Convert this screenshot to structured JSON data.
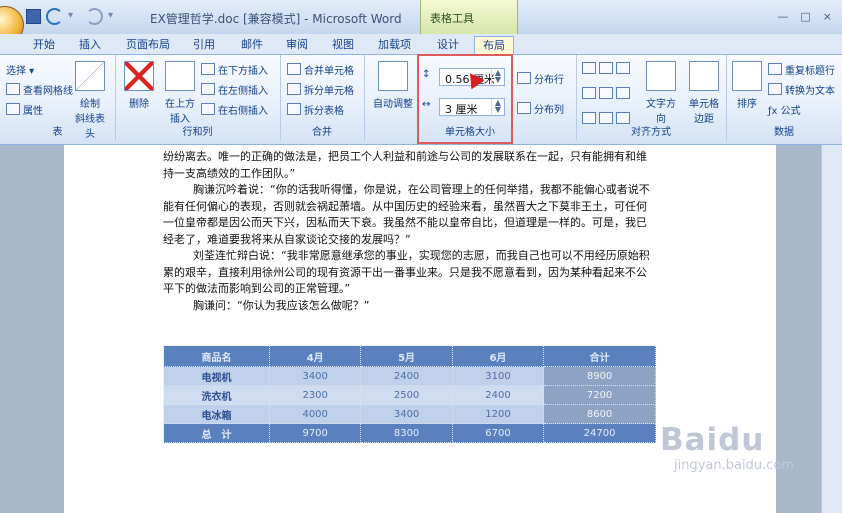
{
  "titlebar": {
    "title": "EX管理哲学.doc [兼容模式] - Microsoft Word",
    "context": "表格工具"
  },
  "tabs": [
    "开始",
    "插入",
    "页面布局",
    "引用",
    "邮件",
    "审阅",
    "视图",
    "加载项",
    "设计",
    "布局"
  ],
  "ribbon": {
    "table": {
      "select": "选择",
      "gridlines": "查看网格线",
      "props": "属性",
      "draw": "绘制",
      "draw2": "斜线表头",
      "title": "表"
    },
    "rowcol": {
      "delete": "删除",
      "insert_above": "在上方",
      "insert2": "插入",
      "below": "在下方插入",
      "left": "在左侧插入",
      "right": "在右侧插入",
      "title": "行和列"
    },
    "merge": {
      "merge_cells": "合并单元格",
      "split_cells": "拆分单元格",
      "split_table": "拆分表格",
      "title": "合并"
    },
    "cellsize": {
      "autofit": "自动调整",
      "height": "0.56 厘米",
      "width": "3 厘米",
      "dist_rows": "分布行",
      "dist_cols": "分布列",
      "title": "单元格大小"
    },
    "align": {
      "direction": "文字方向",
      "margins": "单元格",
      "margins2": "边距",
      "title": "对齐方式"
    },
    "data": {
      "sort": "排序",
      "repeat": "重复标题行",
      "convert": "转换为文本",
      "formula": "公式",
      "title": "数据"
    }
  },
  "document": {
    "paragraphs": [
      "纷纷离去。唯一的正确的做法是，把员工个人利益和前途与公司的发展联系在一起，只有能拥有和维持一支高绩效的工作团队。”",
      "胸谦沉吟着说：“你的话我听得懂，你是说，在公司管理上的任何举措，我都不能偏心或者说不能有任何偏心的表现，否则就会祸起萧墙。从中国历史的经验来看，虽然晋大之下莫非王土，可任何一位皇帝都是因公而天下兴，因私而天下衰。我虽然不能以皇帝自比，但道理是一样的。可是，我已经老了，难道要我将来从自家谈论交接的发展吗？”",
      "刘荃连忙辩白说：“我非常愿意继承您的事业，实现您的志愿，而我自己也可以不用经历原始积累的艰辛，直接利用徐州公司的现有资源干出一番事业来。只是我不愿意看到，因为某种看起来不公平下的做法而影响到公司的正常管理。”",
      "胸谦问：“你认为我应该怎么做呢？”"
    ],
    "table": {
      "headers": [
        "商品名",
        "4月",
        "5月",
        "6月",
        "合计"
      ],
      "rows": [
        [
          "电视机",
          "3400",
          "2400",
          "3100",
          "8900"
        ],
        [
          "洗衣机",
          "2300",
          "2500",
          "2400",
          "7200"
        ],
        [
          "电冰箱",
          "4000",
          "3400",
          "1200",
          "8600"
        ],
        [
          "总　计",
          "9700",
          "8300",
          "6700",
          "24700"
        ]
      ]
    }
  },
  "watermark": {
    "brand": "Baidu",
    "domain": "jingyan.baidu.com"
  }
}
